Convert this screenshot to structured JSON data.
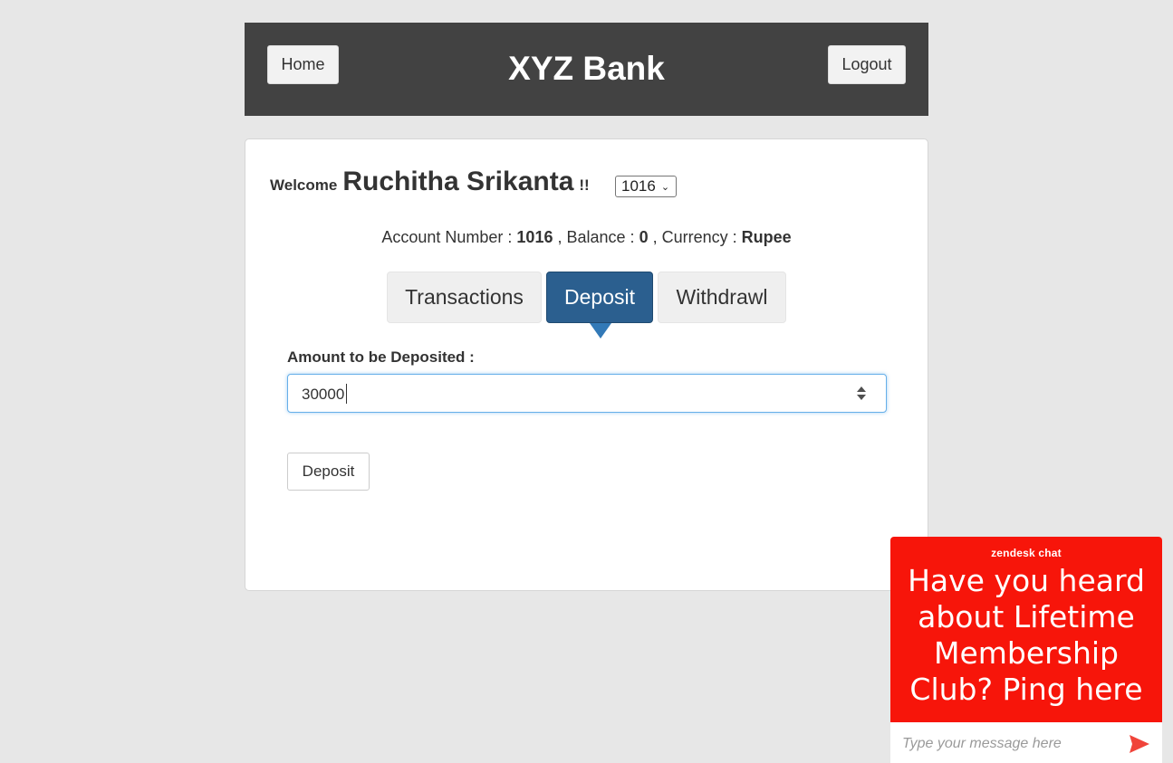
{
  "header": {
    "home_label": "Home",
    "title": "XYZ Bank",
    "logout_label": "Logout"
  },
  "welcome": {
    "prefix": "Welcome",
    "user_name": "Ruchitha Srikanta",
    "suffix": "!!",
    "account_selected": "1016"
  },
  "account_info": {
    "account_label": "Account Number :",
    "account_number": "1016",
    "balance_label": ", Balance :",
    "balance": "0",
    "currency_label": ", Currency :",
    "currency": "Rupee"
  },
  "tabs": [
    {
      "label": "Transactions"
    },
    {
      "label": "Deposit",
      "active": true
    },
    {
      "label": "Withdrawl"
    }
  ],
  "form": {
    "amount_label": "Amount to be Deposited :",
    "amount_value": "30000",
    "submit_label": "Deposit"
  },
  "chat": {
    "brand": "zendesk chat",
    "message": "Have you heard about Lifetime Membership Club? Ping here",
    "placeholder": "Type your message here",
    "icon": "send-icon"
  },
  "colors": {
    "header_bg": "#424242",
    "active_tab": "#2b5f8f",
    "chat_bg": "#f7150a",
    "page_bg": "#e7e7e7"
  }
}
